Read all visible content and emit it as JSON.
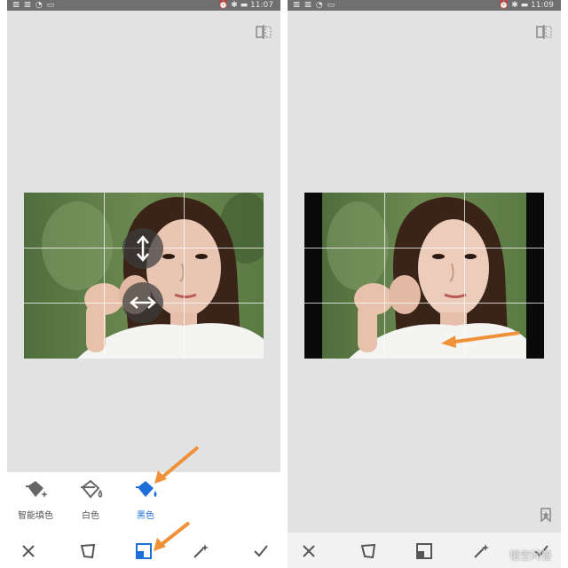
{
  "left_screen": {
    "status": {
      "signals": "𝌆 𝌆 ◔ ▭",
      "right": "⏰ ✱ ▬ 11:07"
    },
    "tools": [
      {
        "label": "智能填色",
        "icon": "bucket-sparkle-icon",
        "active": false
      },
      {
        "label": "白色",
        "icon": "bucket-drop-outline-icon",
        "active": false
      },
      {
        "label": "黑色",
        "icon": "bucket-drop-filled-icon",
        "active": true
      }
    ],
    "bottom_buttons": [
      "close-icon",
      "perspective-icon",
      "expand-icon",
      "auto-magic-icon",
      "check-icon"
    ]
  },
  "right_screen": {
    "status": {
      "signals": "𝌆 𝌆 ◔ ▭",
      "right": "⏰ ✱ ▬ 11:09"
    },
    "bottom_buttons": [
      "close-icon",
      "perspective-icon",
      "expand-icon",
      "auto-magic-icon",
      "check-icon"
    ]
  },
  "watermark": "悟空问答",
  "colors": {
    "accent": "#1e6fd9",
    "annotation": "#f0913a",
    "panel_bg": "#e2e2e2"
  }
}
